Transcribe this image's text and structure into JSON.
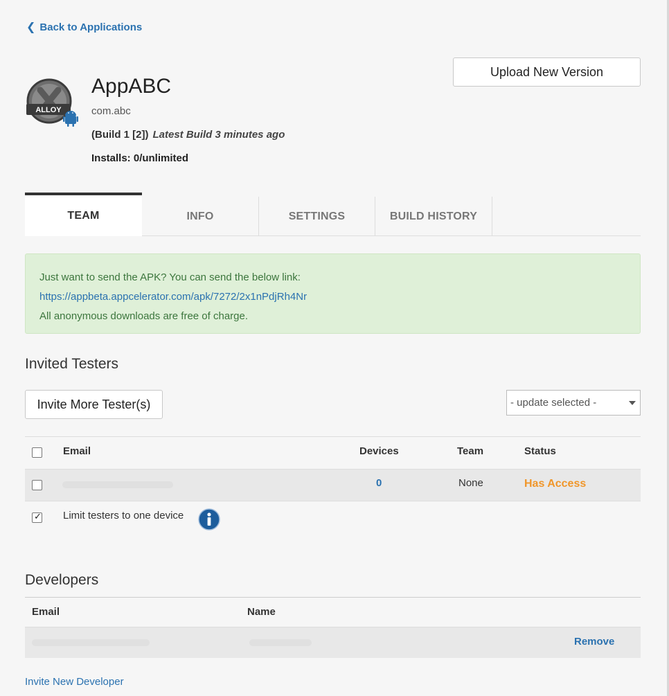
{
  "nav": {
    "back_label": "Back to Applications",
    "back_icon": "chevron-left-icon"
  },
  "header": {
    "upload_label": "Upload New Version",
    "app_name": "AppABC",
    "bundle_id": "com.abc",
    "build": "(Build 1 [2])",
    "latest_build": "Latest Build 3 minutes ago",
    "installs": "Installs:  0/unlimited",
    "icon_label": "ALLOY"
  },
  "tabs": [
    {
      "label": "TEAM",
      "active": true
    },
    {
      "label": "INFO"
    },
    {
      "label": "SETTINGS"
    },
    {
      "label": "BUILD HISTORY"
    }
  ],
  "alert": {
    "line1": "Just want to send the APK? You can send the below link:",
    "link": "https://appbeta.appcelerator.com/apk/7272/2x1nPdjRh4Nr",
    "line3": "All anonymous downloads are free of charge."
  },
  "testers": {
    "heading": "Invited Testers",
    "invite_label": "Invite More Tester(s)",
    "select_value": "- update selected -",
    "columns": [
      "Email",
      "Devices",
      "Team",
      "Status"
    ],
    "rows": [
      {
        "email": "",
        "devices": "0",
        "team": "None",
        "status": "Has Access"
      }
    ],
    "limit_label": "Limit testers to one device"
  },
  "developers": {
    "heading": "Developers",
    "columns": [
      "Email",
      "Name"
    ],
    "rows": [
      {
        "email": "",
        "name": "",
        "action": "Remove"
      }
    ],
    "invite_link": "Invite New Developer"
  },
  "colors": {
    "accent": "#2b72b0",
    "status": "#f0962a",
    "alert_bg": "#dff0d8",
    "alert_text": "#3c763d"
  }
}
